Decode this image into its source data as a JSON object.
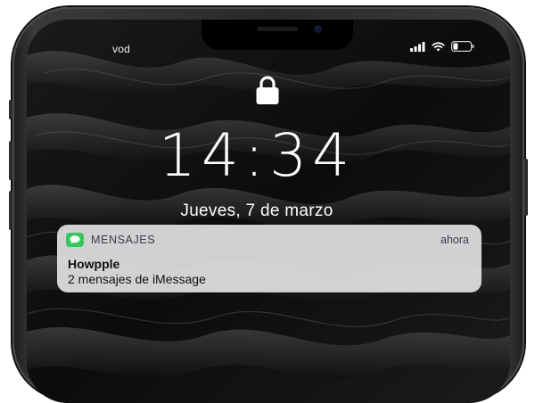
{
  "status_bar": {
    "carrier": "vod",
    "icons": [
      "signal-bars-icon",
      "wifi-icon",
      "battery-icon"
    ]
  },
  "lock_screen": {
    "lock_icon": "lock-icon",
    "time": "14:34",
    "date": "Jueves, 7 de marzo"
  },
  "notification": {
    "app_icon": "messages-icon",
    "app_name": "MENSAJES",
    "time": "ahora",
    "title": "Howpple",
    "body": "2 mensajes de iMessage",
    "accent_color": "#34c759"
  }
}
